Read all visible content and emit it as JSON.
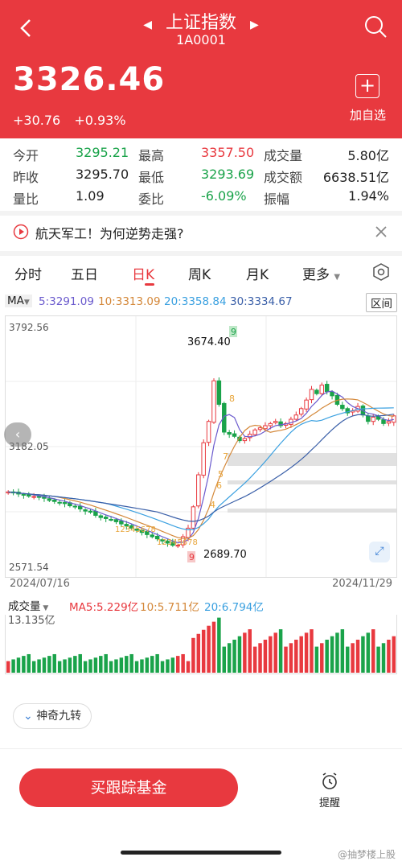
{
  "header": {
    "title": "上证指数",
    "code": "1A0001",
    "price": "3326.46",
    "change": "+30.76",
    "change_pct": "+0.93%",
    "add_label": "加自选"
  },
  "stats": {
    "open_label": "今开",
    "open": "3295.21",
    "high_label": "最高",
    "high": "3357.50",
    "vol_label": "成交量",
    "vol": "5.80亿",
    "prevclose_label": "昨收",
    "prevclose": "3295.70",
    "low_label": "最低",
    "low": "3293.69",
    "amount_label": "成交额",
    "amount": "6638.51亿",
    "volratio_label": "量比",
    "volratio": "1.09",
    "weibi_label": "委比",
    "weibi": "-6.09%",
    "amplitude_label": "振幅",
    "amplitude": "1.94%"
  },
  "news": {
    "text": "航天军工！为何逆势走强?"
  },
  "tabs": [
    "分时",
    "五日",
    "日K",
    "周K",
    "月K",
    "更多"
  ],
  "active_tab": "日K",
  "ma": {
    "selector": "MA",
    "ma5": "5:3291.09",
    "ma10": "10:3313.09",
    "ma20": "20:3358.84",
    "ma30": "30:3334.67",
    "range_btn": "区间"
  },
  "colors": {
    "brand": "#e8393f",
    "down": "#1aa34a",
    "ma5": "#6a5acd",
    "ma10": "#d4883a",
    "ma20": "#3aa0e0",
    "ma30": "#3a5fa8"
  },
  "chart_labels": {
    "y_top": "3792.56",
    "y_mid": "3182.05",
    "y_bottom": "2571.54",
    "peak_label": "3674.40",
    "trough_label": "2689.70",
    "date_start": "2024/07/16",
    "date_end": "2024/11/29",
    "nine_top": "9",
    "nine_bottom": "9",
    "up_counts": [
      "8",
      "7",
      "6",
      "5",
      "4"
    ],
    "down_counts": "12345678",
    "down_counts2": "12345678"
  },
  "volume": {
    "label": "成交量",
    "ma5": "MA5:5.229亿",
    "ma10": "10:5.711亿",
    "ma20": "20:6.794亿",
    "max": "13.135亿"
  },
  "jiuzhuan": "神奇九转",
  "footer": {
    "buy_label": "买跟踪基金",
    "remind_label": "提醒",
    "watermark": "@抽梦楼上股"
  },
  "chart_data": {
    "type": "candlestick",
    "x_range": [
      "2024/07/16",
      "2024/11/29"
    ],
    "ylim": [
      2571.54,
      3792.56
    ],
    "annotations": [
      {
        "label": "3674.40",
        "value": 3674.4
      },
      {
        "label": "2689.70",
        "value": 2689.7
      }
    ],
    "close_series": [
      2970,
      2965,
      2960,
      2955,
      2950,
      2948,
      2945,
      2940,
      2930,
      2925,
      2920,
      2915,
      2905,
      2900,
      2890,
      2880,
      2875,
      2860,
      2850,
      2845,
      2840,
      2830,
      2820,
      2810,
      2800,
      2790,
      2780,
      2770,
      2760,
      2750,
      2740,
      2730,
      2720,
      2720,
      2760,
      2800,
      2900,
      3050,
      3200,
      3300,
      3490,
      3380,
      3250,
      3240,
      3230,
      3210,
      3220,
      3240,
      3260,
      3270,
      3280,
      3290,
      3300,
      3280,
      3290,
      3310,
      3330,
      3360,
      3400,
      3450,
      3430,
      3470,
      3440,
      3420,
      3380,
      3360,
      3340,
      3350,
      3370,
      3330,
      3300,
      3320,
      3310,
      3290,
      3300,
      3326
    ]
  }
}
